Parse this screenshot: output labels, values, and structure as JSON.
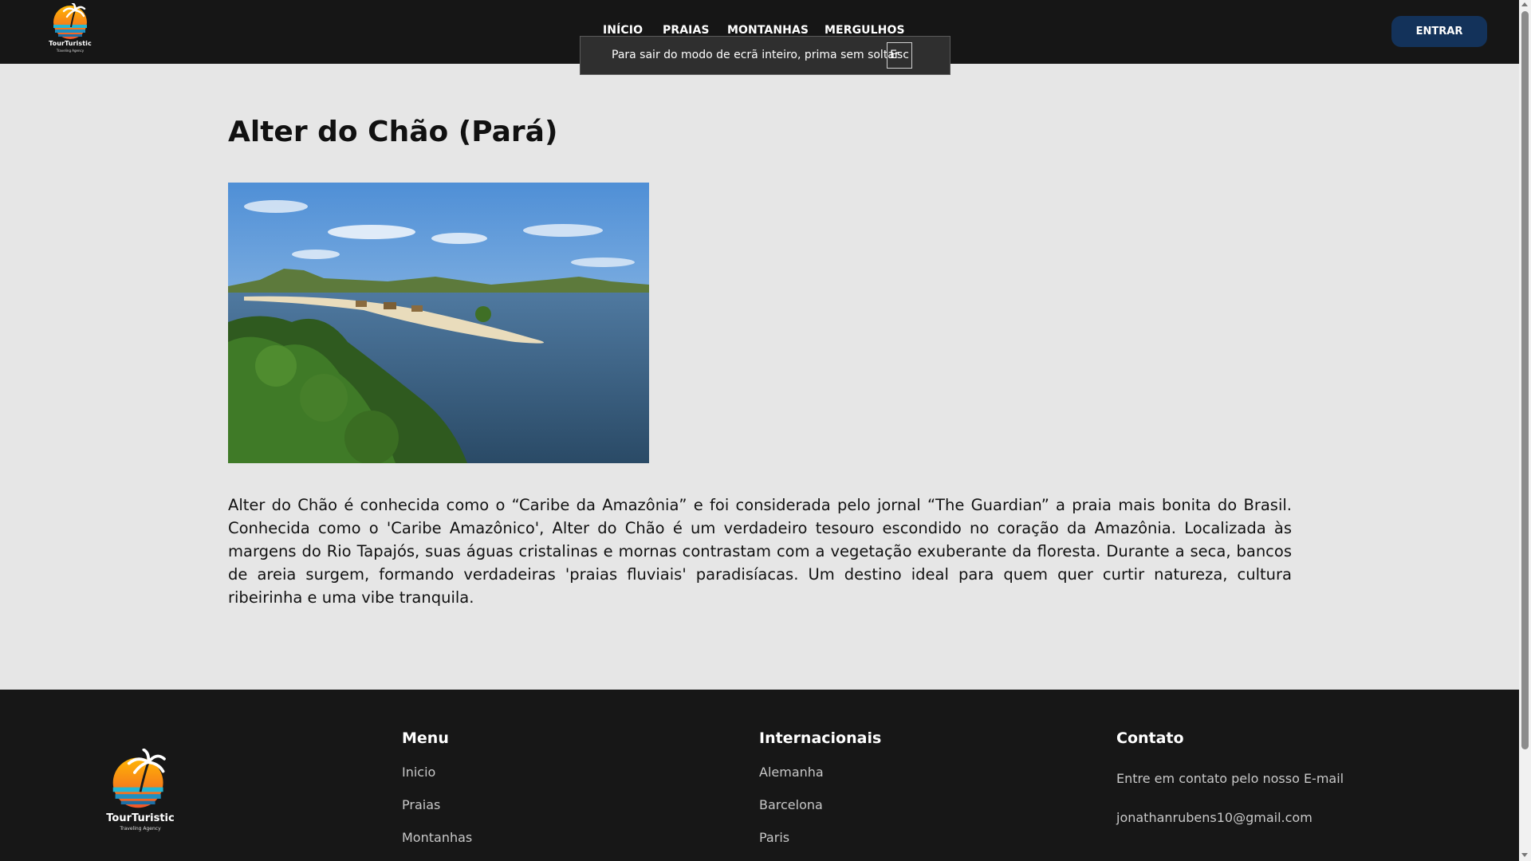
{
  "header": {
    "logo": {
      "name": "TourTuristic",
      "tagline": "Traveling Agency"
    },
    "nav": [
      {
        "label": "INÍCIO"
      },
      {
        "label": "PRAIAS"
      },
      {
        "label": "MONTANHAS"
      },
      {
        "label": "MERGULHOS"
      }
    ],
    "login_label": "ENTRAR",
    "colors": {
      "background": "#161616",
      "login_button": "#13325a"
    }
  },
  "fullscreen_notice": {
    "text": "Para sair do modo de ecrã inteiro, prima sem soltar",
    "key": "Esc"
  },
  "main": {
    "title": "Alter do Chão (Pará)",
    "image_alt_icon": "beach-river-photo",
    "description": "Alter do Chão é conhecida como o “Caribe da Amazônia” e foi considerada pelo jornal “The Guardian” a praia mais bonita do Brasil. Conhecida como o 'Caribe Amazônico', Alter do Chão é um verdadeiro tesouro escondido no coração da Amazônia. Localizada às margens do Rio Tapajós, suas águas cristalinas e mornas contrastam com a vegetação exuberante da floresta. Durante a seca, bancos de areia surgem, formando verdadeiras 'praias fluviais' paradisíacas. Um destino ideal para quem quer curtir natureza, cultura ribeirinha e uma vibe tranquila."
  },
  "footer": {
    "logo": {
      "name": "TourTuristic",
      "tagline": "Traveling Agency"
    },
    "menu": {
      "title": "Menu",
      "items": [
        {
          "label": "Inicio"
        },
        {
          "label": "Praias"
        },
        {
          "label": "Montanhas"
        }
      ]
    },
    "international": {
      "title": "Internacionais",
      "items": [
        {
          "label": "Alemanha"
        },
        {
          "label": "Barcelona"
        },
        {
          "label": "Paris"
        }
      ]
    },
    "contact": {
      "title": "Contato",
      "text": "Entre em contato pelo nosso E-mail",
      "email": "jonathanrubens10@gmail.com"
    }
  }
}
